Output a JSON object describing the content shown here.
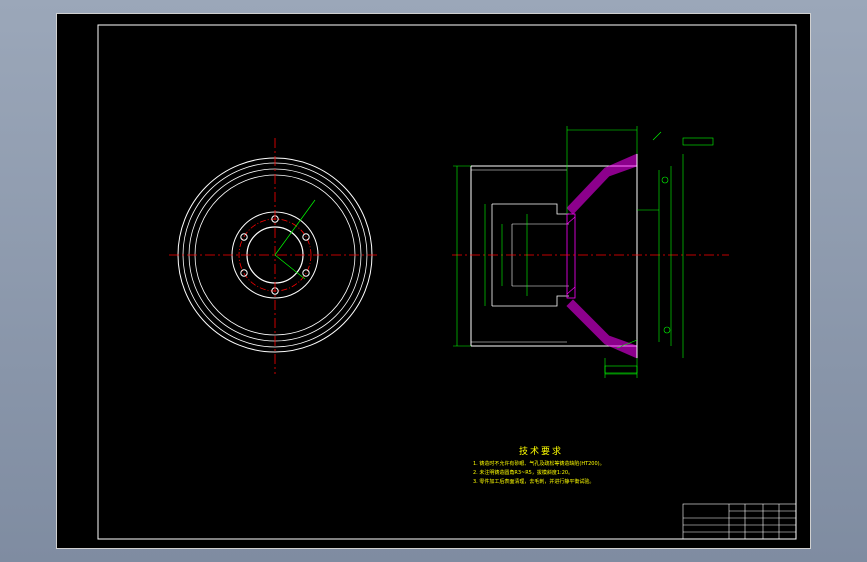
{
  "colors": {
    "background": "#000000",
    "frame": "#ffffff",
    "geometry": "#ffffff",
    "dimension": "#00ff00",
    "centerline": "#ff0000",
    "hatch": "#ff00ff",
    "notes": "#ffff00",
    "axis_marker": "#ff0000"
  },
  "views": {
    "front_view": {
      "label": "front-view-of-brake-drum"
    },
    "section_view": {
      "label": "section-view-of-brake-drum"
    }
  },
  "technical_requirements": {
    "title": "技术要求",
    "items": [
      "1. 铸造时不允许有砂眼、气孔及疏松等铸造缺陷(HT200)。",
      "2. 未注明铸造圆角R3~R5，拔模斜度1:20。",
      "3. 零件加工后表面清理，去毛刺，并进行静平衡试验。"
    ]
  }
}
